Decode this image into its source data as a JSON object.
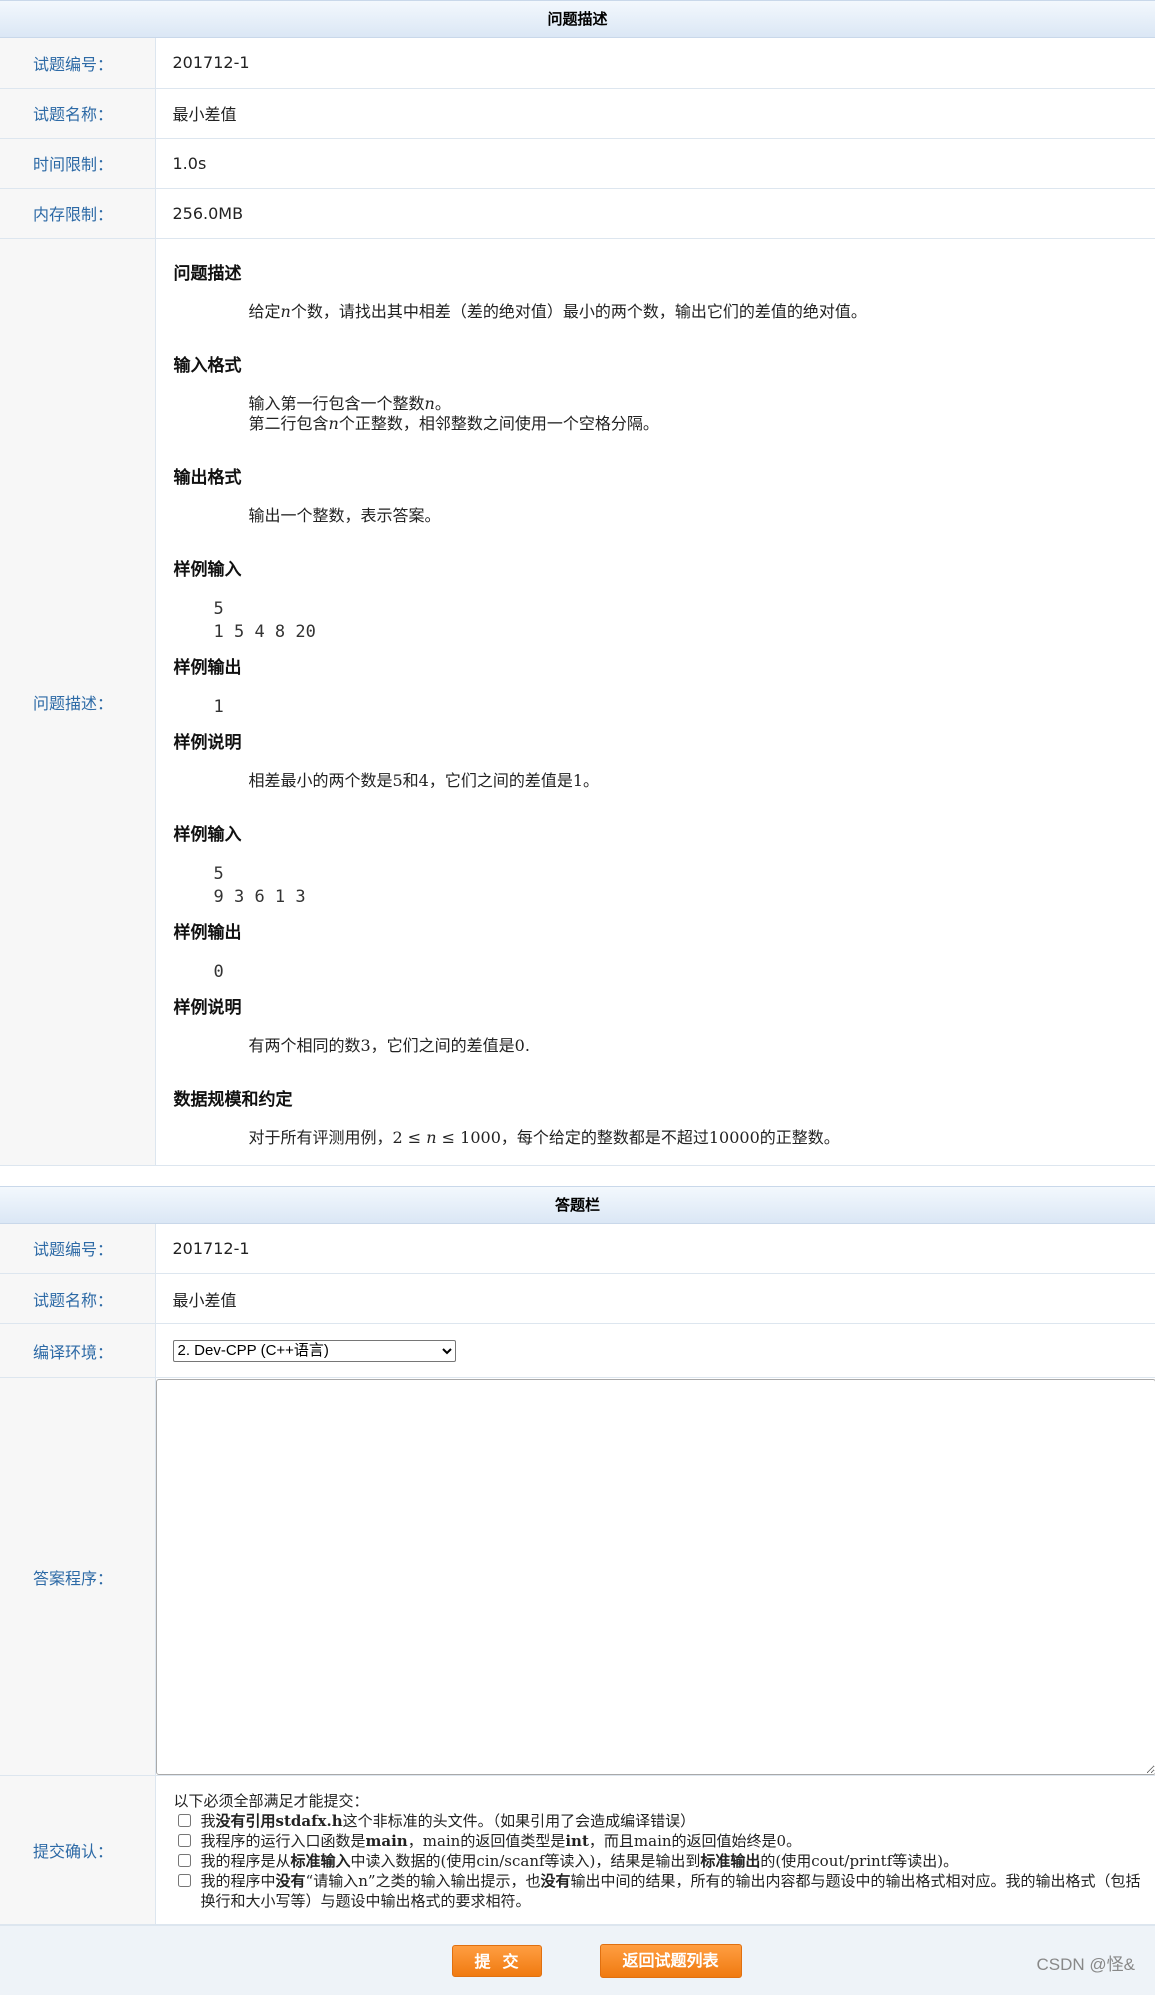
{
  "problem": {
    "header": "问题描述",
    "rows": [
      {
        "label": "试题编号：",
        "value": "201712-1"
      },
      {
        "label": "试题名称：",
        "value": "最小差值"
      },
      {
        "label": "时间限制：",
        "value": "1.0s"
      },
      {
        "label": "内存限制：",
        "value": "256.0MB"
      }
    ],
    "desc_label": "问题描述：",
    "sections": {
      "desc_title": "问题描述",
      "desc_text_a": "给定",
      "var_n": "n",
      "desc_text_b": "个数，请找出其中相差（差的绝对值）最小的两个数，输出它们的差值的绝对值。",
      "input_title": "输入格式",
      "input_line1_a": "输入第一行包含一个整数",
      "input_line1_b": "。",
      "input_line2_a": "第二行包含",
      "input_line2_b": "个正整数，相邻整数之间使用一个空格分隔。",
      "output_title": "输出格式",
      "output_text": "输出一个整数，表示答案。",
      "sample_in_title": "样例输入",
      "sample_in_1": "5\n1 5 4 8 20",
      "sample_out_title": "样例输出",
      "sample_out_1": "1",
      "explain_title": "样例说明",
      "explain_1": "相差最小的两个数是5和4，它们之间的差值是1。",
      "sample_in_2": "5\n9 3 6 1 3",
      "sample_out_2": "0",
      "explain_2": "有两个相同的数3，它们之间的差值是0.",
      "scale_title": "数据规模和约定",
      "scale_a": "对于所有评测用例，2 ≤ ",
      "scale_b": " ≤ 1000，每个给定的整数都是不超过10000的正整数。"
    }
  },
  "answer": {
    "header": "答题栏",
    "rows": [
      {
        "label": "试题编号：",
        "value": "201712-1"
      },
      {
        "label": "试题名称：",
        "value": "最小差值"
      }
    ],
    "env_label": "编译环境：",
    "env_selected": "2. Dev-CPP (C++语言)",
    "code_label": "答案程序：",
    "confirm_label": "提交确认：",
    "confirm_intro": "以下必须全部满足才能提交：",
    "check1_a": "我",
    "check1_b": "没有引用stdafx.h",
    "check1_c": "这个非标准的头文件。（如果引用了会造成编译错误）",
    "check2_a": "我程序的运行入口函数是",
    "check2_b": "main",
    "check2_c": "，main的返回值类型是",
    "check2_d": "int",
    "check2_e": "，而且main的返回值始终是0。",
    "check3_a": "我的程序是从",
    "check3_b": "标准输入",
    "check3_c": "中读入数据的(使用cin/scanf等读入)，结果是输出到",
    "check3_d": "标准输出",
    "check3_e": "的(使用cout/printf等读出)。",
    "check4_a": "我的程序中",
    "check4_b": "没有",
    "check4_c": "“请输入n”之类的输入输出提示，也",
    "check4_d": "没有",
    "check4_e": "输出中间的结果，所有的输出内容都与题设中的输出格式相对应。我的输出格式（包括换行和大小写等）与题设中输出格式的要求相符。"
  },
  "buttons": {
    "submit": "提交",
    "back": "返回试题列表"
  },
  "watermark": "CSDN @怪&"
}
